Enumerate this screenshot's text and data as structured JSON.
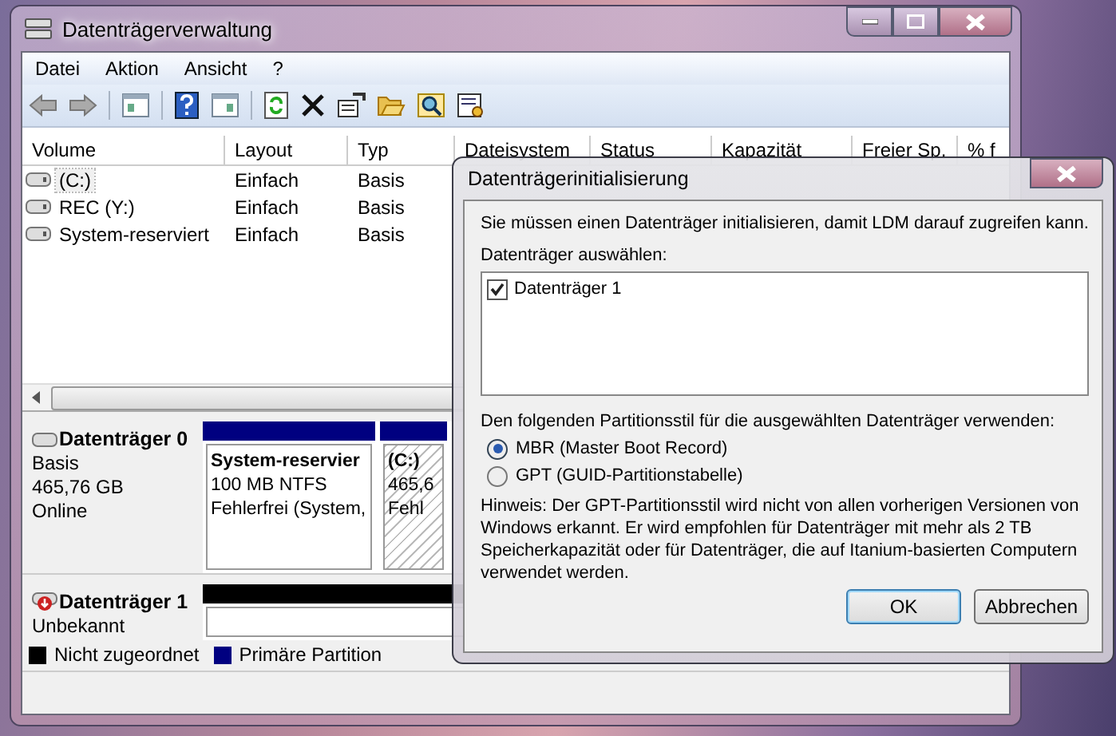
{
  "window": {
    "title": "Datenträgerverwaltung"
  },
  "menu": [
    "Datei",
    "Aktion",
    "Ansicht",
    "?"
  ],
  "volume_table": {
    "columns": [
      "Volume",
      "Layout",
      "Typ",
      "Dateisystem",
      "Status",
      "Kapazität",
      "Freier Sp.",
      "% f"
    ],
    "rows": [
      {
        "volume": "(C:)",
        "layout": "Einfach",
        "type": "Basis",
        "selected": true
      },
      {
        "volume": "REC (Y:)",
        "layout": "Einfach",
        "type": "Basis",
        "selected": false
      },
      {
        "volume": "System-reserviert",
        "layout": "Einfach",
        "type": "Basis",
        "selected": false
      }
    ]
  },
  "disks": [
    {
      "name": "Datenträger 0",
      "kind": "online",
      "lines": [
        "Basis",
        "465,76 GB",
        "Online"
      ],
      "partitions": [
        {
          "kind": "primary",
          "name": "System-reservier",
          "detail": "100 MB NTFS",
          "status": "Fehlerfrei (System,"
        },
        {
          "kind": "primary_hatched",
          "name": "(C:)",
          "detail": "465,6",
          "status": "Fehl"
        }
      ]
    },
    {
      "name": "Datenträger 1",
      "kind": "unknown",
      "lines": [
        "Unbekannt"
      ],
      "partitions": [
        {
          "kind": "unallocated"
        }
      ]
    }
  ],
  "legend": [
    {
      "label": "Nicht zugeordnet",
      "color": "#000000"
    },
    {
      "label": "Primäre Partition",
      "color": "#000080"
    }
  ],
  "dialog": {
    "title": "Datenträgerinitialisierung",
    "intro": "Sie müssen einen Datenträger initialisieren, damit LDM darauf zugreifen kann.",
    "list_label": "Datenträger auswählen:",
    "disks": [
      {
        "label": "Datenträger 1",
        "checked": true
      }
    ],
    "style_label": "Den folgenden Partitionsstil für die ausgewählten Datenträger verwenden:",
    "options": [
      {
        "label": "MBR (Master Boot Record)",
        "selected": true
      },
      {
        "label": "GPT (GUID-Partitionstabelle)",
        "selected": false
      }
    ],
    "note": "Hinweis: Der GPT-Partitionsstil wird nicht von allen vorherigen Versionen von Windows erkannt. Er wird empfohlen für Datenträger mit mehr als 2 TB Speicherkapazität oder für Datenträger, die auf Itanium-basierten Computern verwendet werden.",
    "buttons": [
      "OK",
      "Abbrechen"
    ]
  }
}
